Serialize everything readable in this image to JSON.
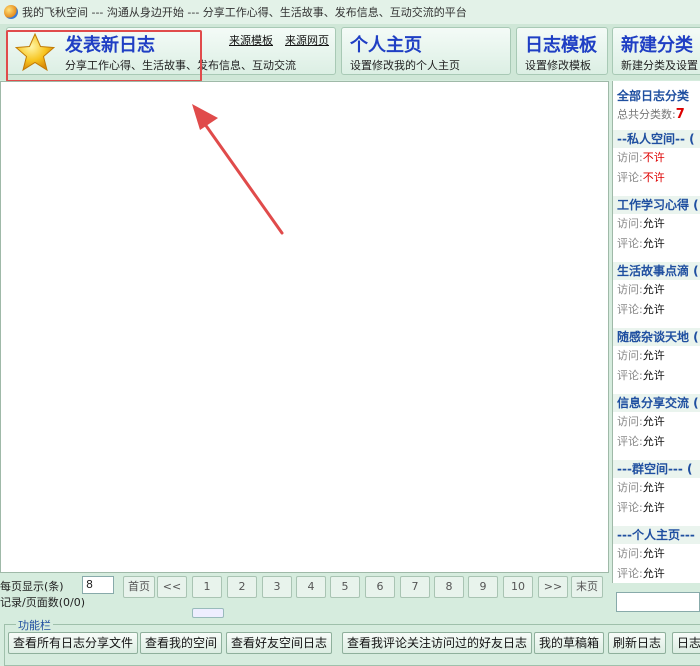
{
  "window": {
    "title": "我的飞秋空间 --- 沟通从身边开始 --- 分享工作心得、生活故事、发布信息、互动交流的平台"
  },
  "toolbar": {
    "publish": {
      "title": "发表新日志",
      "subtitle": "分享工作心得、生活故事、发布信息、互动交流",
      "link_template": "来源模板",
      "link_web": "来源网页"
    },
    "home": {
      "title": "个人主页",
      "subtitle": "设置修改我的个人主页"
    },
    "template": {
      "title": "日志模板",
      "subtitle": "设置修改模板"
    },
    "category": {
      "title": "新建分类",
      "subtitle": "新建分类及设置"
    }
  },
  "sidebar": {
    "heading": "全部日志分类",
    "count_label": "总共分类数:",
    "count_value": "7",
    "categories": [
      {
        "name": "--私人空间-- (",
        "visit_label": "访问:",
        "visit": "不许",
        "comment_label": "评论:",
        "comment": "不许"
      },
      {
        "name": "工作学习心得 (",
        "visit_label": "访问:",
        "visit": "允许",
        "comment_label": "评论:",
        "comment": "允许"
      },
      {
        "name": "生活故事点滴 (",
        "visit_label": "访问:",
        "visit": "允许",
        "comment_label": "评论:",
        "comment": "允许"
      },
      {
        "name": "随感杂谈天地 (",
        "visit_label": "访问:",
        "visit": "允许",
        "comment_label": "评论:",
        "comment": "允许"
      },
      {
        "name": "信息分享交流 (",
        "visit_label": "访问:",
        "visit": "允许",
        "comment_label": "评论:",
        "comment": "允许"
      },
      {
        "name": "---群空间--- (",
        "visit_label": "访问:",
        "visit": "允许",
        "comment_label": "评论:",
        "comment": "允许"
      },
      {
        "name": "---个人主页---",
        "visit_label": "访问:",
        "visit": "允许",
        "comment_label": "评论:",
        "comment": "允许"
      }
    ]
  },
  "pager": {
    "per_page_label": "每页显示(条)",
    "per_page_value": "8",
    "record_info": "记录/页面数(0/0)",
    "first": "首页",
    "prev": "<<",
    "pages": [
      "1",
      "2",
      "3",
      "4",
      "5",
      "6",
      "7",
      "8",
      "9",
      "10"
    ],
    "next": ">>",
    "last": "末页"
  },
  "funcbar": {
    "label": "功能栏",
    "buttons": [
      "查看所有日志分享文件",
      "查看我的空间",
      "查看好友空间日志",
      "查看我评论关注访问过的好友日志",
      "我的草稿箱",
      "刷新日志",
      "日志"
    ]
  },
  "colors": {
    "annotation_red": "#e04b4b",
    "link_blue": "#1f3fc4",
    "deny_red": "#dd0000"
  }
}
